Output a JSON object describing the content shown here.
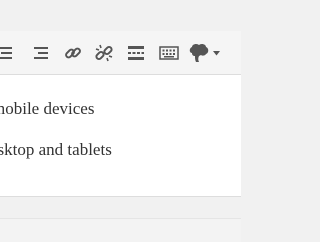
{
  "toolbar": {
    "buttons": [
      {
        "name": "align-center",
        "icon": "align-center-icon",
        "label": "Align center"
      },
      {
        "name": "align-right",
        "icon": "align-right-icon",
        "label": "Align right"
      },
      {
        "name": "insert-link",
        "icon": "link-icon",
        "label": "Insert/edit link"
      },
      {
        "name": "remove-link",
        "icon": "unlink-icon",
        "label": "Remove link"
      },
      {
        "name": "read-more",
        "icon": "read-more-icon",
        "label": "Insert Read More tag"
      },
      {
        "name": "toolbar-toggle",
        "icon": "keyboard-icon",
        "label": "Toolbar Toggle"
      },
      {
        "name": "plugin-menu",
        "icon": "brain-icon",
        "label": "Menu"
      }
    ],
    "icon_color": "#555555"
  },
  "content": {
    "line1": "mobile devices",
    "line2": "esktop and tablets"
  }
}
